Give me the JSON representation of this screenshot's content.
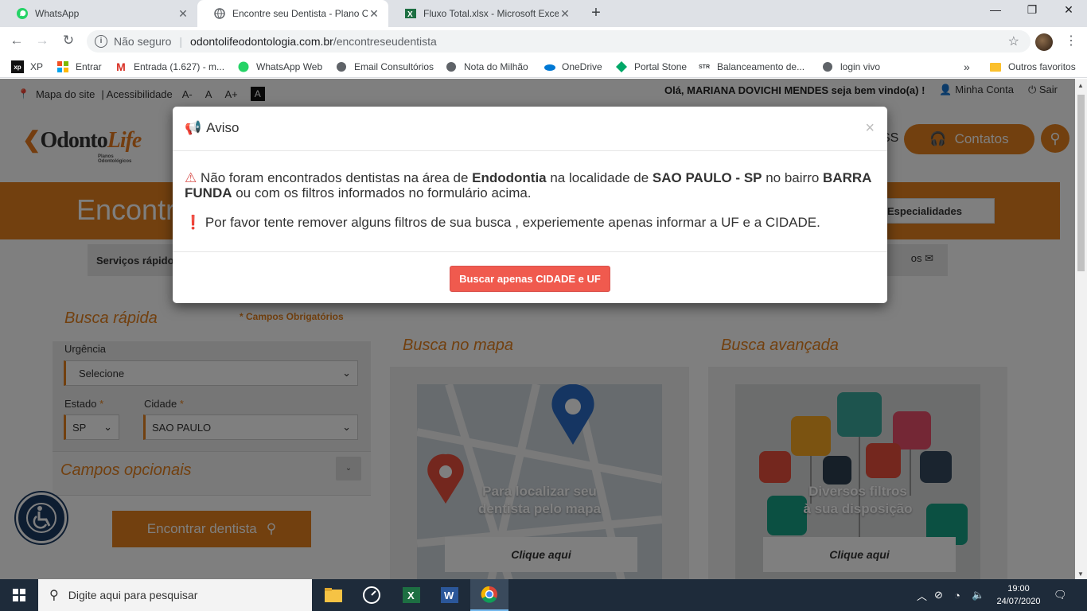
{
  "browser": {
    "tabs": [
      {
        "title": "WhatsApp",
        "icon": "whatsapp-icon"
      },
      {
        "title": "Encontre seu Dentista - Plano Odontológico",
        "icon": "globe-icon"
      },
      {
        "title": "Fluxo Total.xlsx - Microsoft Excel Online",
        "icon": "excel-icon"
      }
    ],
    "address": {
      "security": "Não seguro",
      "host": "odontolifeodontologia.com.br",
      "path": "/encontreseudentista"
    },
    "bookmarks": [
      {
        "label": "XP",
        "icon": "xp-icon"
      },
      {
        "label": "Entrar",
        "icon": "microsoft-icon"
      },
      {
        "label": "Entrada (1.627) - m...",
        "icon": "gmail-icon"
      },
      {
        "label": "WhatsApp Web",
        "icon": "whatsapp-icon"
      },
      {
        "label": "Email Consultórios",
        "icon": "globe-icon"
      },
      {
        "label": "Nota do Milhão",
        "icon": "globe-icon"
      },
      {
        "label": "OneDrive",
        "icon": "onedrive-icon"
      },
      {
        "label": "Portal Stone",
        "icon": "stone-icon"
      },
      {
        "label": "Balanceamento de...",
        "icon": "str-icon"
      },
      {
        "label": "login vivo",
        "icon": "globe-icon"
      }
    ],
    "more_bookmarks": "»",
    "other_favorites": "Outros favoritos"
  },
  "site": {
    "topbar": {
      "sitemap": "Mapa do site",
      "accessibility": "| Acessibilidade",
      "font_minus": "A-",
      "font_normal": "A",
      "font_plus": "A+",
      "contrast": "A",
      "welcome": "Olá, MARIANA DOVICHI MENDES seja bem vindo(a) !",
      "account": "Minha Conta",
      "logout": "Sair"
    },
    "logo": {
      "odonto": "Odonto",
      "life": "Life",
      "tagline": "Planos Odontológicos"
    },
    "nav_partial": "SS",
    "contatos": "Contatos",
    "banner_title": "Encontr",
    "especialidades": "Especialidades",
    "servicos": "Serviços rápido",
    "servicos_right": "os",
    "busca_rapida": {
      "title": "Busca rápida",
      "required_note": "* Campos Obrigatórios",
      "urgencia_label": "Urgência",
      "urgencia_value": "Selecione",
      "estado_label": "Estado",
      "estado_value": "SP",
      "cidade_label": "Cidade",
      "cidade_value": "SAO PAULO",
      "req_mark": "*",
      "opcionais": "Campos opcionais",
      "find_button": "Encontrar dentista"
    },
    "busca_mapa": {
      "title": "Busca no mapa",
      "caption_1": "Para localizar seu",
      "caption_2": "dentista pelo mapa",
      "button": "Clique aqui"
    },
    "busca_avancada": {
      "title": "Busca avançada",
      "caption_1": "Diversos filtros",
      "caption_2": "à sua disposição",
      "button": "Clique aqui"
    }
  },
  "modal": {
    "title": "Aviso",
    "close": "×",
    "msg1_a": "Não foram encontrados dentistas na área de ",
    "msg1_b": "Endodontia",
    "msg1_c": " na localidade de ",
    "msg1_d": "SAO PAULO - SP",
    "msg1_e": " no bairro ",
    "msg1_f": "BARRA FUNDA",
    "msg1_g": " ou com os filtros informados no formulário acima.",
    "msg2": "Por favor tente remover alguns filtros de sua busca , experiemente apenas informar a UF e a CIDADE.",
    "button": "Buscar apenas CIDADE e UF"
  },
  "taskbar": {
    "search_placeholder": "Digite aqui para pesquisar",
    "time": "19:00",
    "date": "24/07/2020"
  },
  "colors": {
    "brand_orange": "#e4801e",
    "modal_button": "#f05a4e",
    "taskbar": "#1e2b3a"
  }
}
